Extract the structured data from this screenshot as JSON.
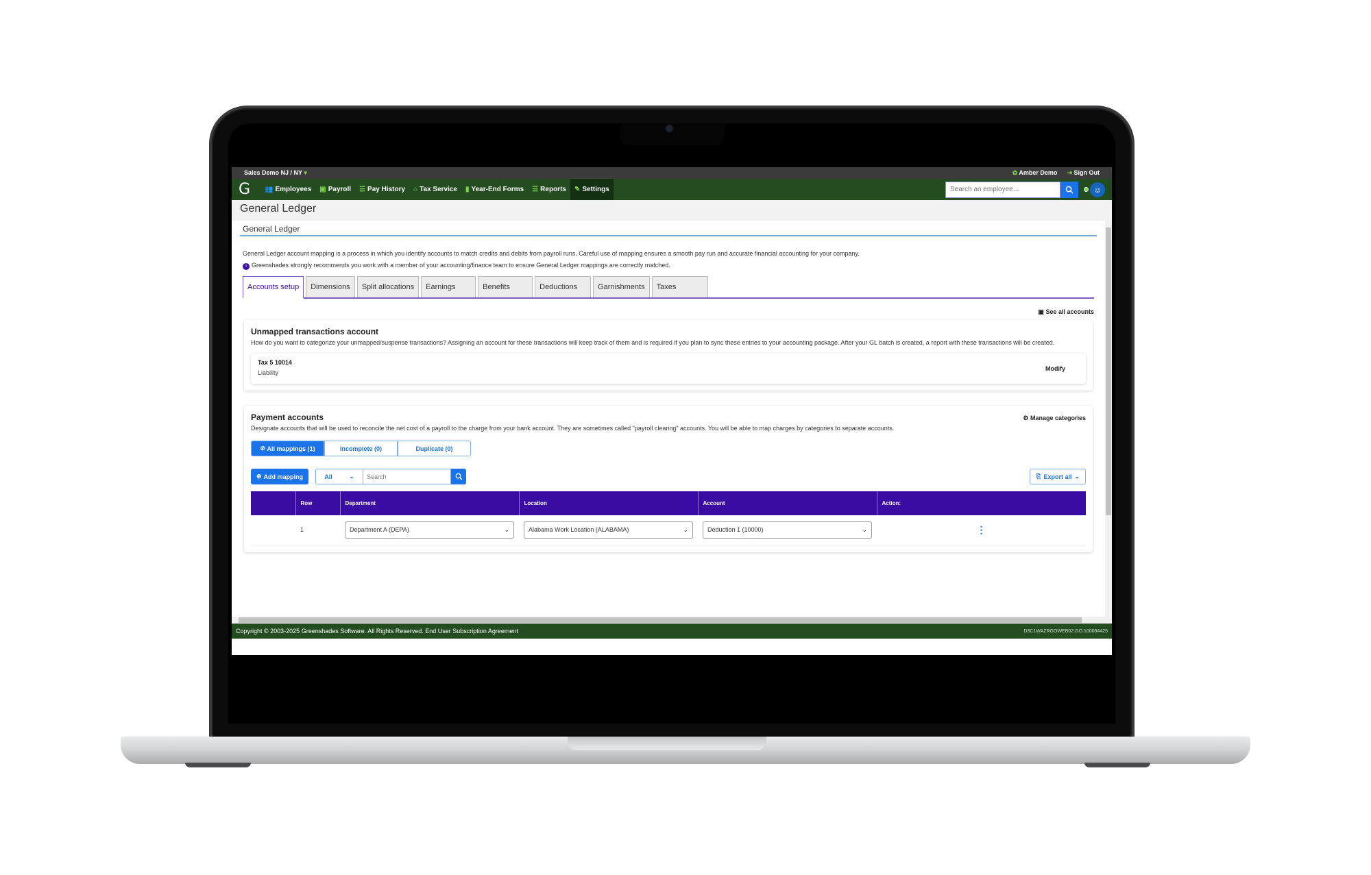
{
  "topbar": {
    "company": "Sales Demo NJ / NY",
    "company_caret": "▾",
    "user": "Amber Demo",
    "signout": "Sign Out"
  },
  "nav": {
    "logo": "G",
    "items": [
      {
        "label": "Employees",
        "icon": "people-icon",
        "glyph": "👥"
      },
      {
        "label": "Payroll",
        "icon": "money-icon",
        "glyph": "▣"
      },
      {
        "label": "Pay History",
        "icon": "list-icon",
        "glyph": "☰"
      },
      {
        "label": "Tax Service",
        "icon": "bank-icon",
        "glyph": "⌂"
      },
      {
        "label": "Year-End Forms",
        "icon": "document-icon",
        "glyph": "▮"
      },
      {
        "label": "Reports",
        "icon": "list-icon",
        "glyph": "☰"
      },
      {
        "label": "Settings",
        "icon": "wrench-icon",
        "glyph": "✎",
        "active": true
      }
    ],
    "search_placeholder": "Search an employee..."
  },
  "page": {
    "title": "General Ledger",
    "subtitle": "General Ledger",
    "intro": "General Ledger account mapping is a process in which you identify accounts to match credits and debits from payroll runs. Careful use of mapping ensures a smooth pay run and accurate financial accounting for your company.",
    "notice": "Greenshades strongly recommends you work with a member of your accounting/finance team to ensure General Ledger mappings are correctly matched."
  },
  "tabs": [
    "Accounts setup",
    "Dimensions",
    "Split allocations",
    "Earnings",
    "Benefits",
    "Deductions",
    "Garnishments",
    "Taxes"
  ],
  "active_tab": "Accounts setup",
  "see_all_accounts": "See all accounts",
  "unmapped": {
    "title": "Unmapped transactions account",
    "description": "How do you want to categorize your unmapped/suspense transactions? Assigning an account for these transactions will keep track of them and is required if you plan to sync these entries to your accounting package. After your GL batch is created, a report with these transactions will be created.",
    "account_name": "Tax 5 10014",
    "account_type": "Liability",
    "modify_label": "Modify"
  },
  "payment": {
    "title": "Payment accounts",
    "manage_label": "Manage categories",
    "description": "Designate accounts that will be used to reconcile the net cost of a payroll to the charge from your bank account. They are sometimes called \"payroll clearing\" accounts. You will be able to map charges by categories to separate accounts.",
    "segments": [
      "All mappings (1)",
      "Incomplete (0)",
      "Duplicate (0)"
    ],
    "add_mapping": "Add mapping",
    "filter_value": "All",
    "search_placeholder": "Search",
    "export_label": "Export all",
    "columns": [
      "",
      "Row",
      "Department",
      "Location",
      "Account",
      "Action:"
    ],
    "rows": [
      {
        "row": "1",
        "department": "Department A (DEPA)",
        "location": "Alabama Work Location (ALABAMA)",
        "account": "Deduction 1 (10000)"
      }
    ]
  },
  "footer": {
    "copyright": "Copyright © 2003-2025 Greenshades Software. All Rights Reserved. End User Subscription Agreement",
    "server_code": "D3C1WAZRGOWEB02:GO:100084425"
  },
  "colors": {
    "nav_green": "#234d20",
    "accent_green": "#7ad14a",
    "primary_blue": "#1a73e8",
    "table_header_purple": "#3a0ca3"
  }
}
